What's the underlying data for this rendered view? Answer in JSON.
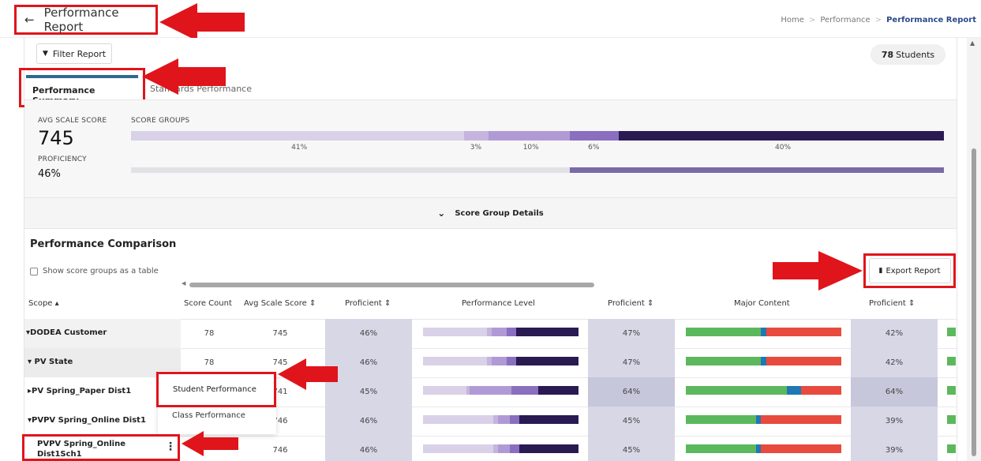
{
  "header": {
    "title": "Performance Report",
    "back_icon": "←",
    "breadcrumb": [
      "Home",
      "Performance",
      "Performance Report"
    ],
    "breadcrumb_sep": ">"
  },
  "toolbar": {
    "filter_label": "Filter Report",
    "students_count": "78",
    "students_label": "Students"
  },
  "tabs": [
    {
      "label": "Performance Summary",
      "active": true
    },
    {
      "label": "Standards Performance",
      "active": false
    }
  ],
  "summary": {
    "avg_scale_score_label": "AVG SCALE SCORE",
    "avg_scale_score": "745",
    "proficiency_label": "PROFICIENCY",
    "proficiency": "46%",
    "score_groups_label": "SCORE GROUPS",
    "score_groups": [
      {
        "pct": 41,
        "label": "41%",
        "color": "#d9d1e8"
      },
      {
        "pct": 3,
        "label": "3%",
        "color": "#c5b5de"
      },
      {
        "pct": 10,
        "label": "10%",
        "color": "#b09ad5"
      },
      {
        "pct": 6,
        "label": "6%",
        "color": "#8a6fc0"
      },
      {
        "pct": 40,
        "label": "40%",
        "color": "#2a1a52"
      }
    ],
    "proficiency_bar": {
      "pct": 46,
      "bg": "#e2e2e6",
      "fill": "#7a6aa8"
    }
  },
  "details_toggle": {
    "icon": "⌄",
    "label": "Score Group Details"
  },
  "comparison": {
    "title": "Performance Comparison",
    "show_table_label": "Show score groups as a table",
    "export_label": "Export Report",
    "columns": [
      "Scope ▴",
      "Score Count",
      "Avg Scale Score ⇕",
      "Proficient ⇕",
      "Performance Level",
      "Proficient ⇕",
      "Major Content",
      "Proficient ⇕"
    ],
    "rows": [
      {
        "scope": "▾DODEA Customer",
        "count": "78",
        "avg": "745",
        "prof1": "46%",
        "prof2": "47%",
        "prof3": "42%",
        "pl": [
          41,
          3,
          10,
          6,
          40
        ],
        "mc": [
          48,
          4,
          48
        ]
      },
      {
        "scope": "▾ PV State",
        "count": "78",
        "avg": "745",
        "prof1": "46%",
        "prof2": "47%",
        "prof3": "42%",
        "pl": [
          41,
          3,
          10,
          6,
          40
        ],
        "mc": [
          48,
          4,
          48
        ]
      },
      {
        "scope": "▸PV Spring_Paper Dist1",
        "count": "",
        "avg": "741",
        "prof1": "45%",
        "prof2": "64%",
        "prof3": "64%",
        "pl": [
          28,
          2,
          27,
          17,
          26
        ],
        "mc": [
          65,
          9,
          26
        ]
      },
      {
        "scope": "▾PVPV Spring_Online Dist1",
        "count": "",
        "avg": "746",
        "prof1": "46%",
        "prof2": "45%",
        "prof3": "39%",
        "pl": [
          45,
          3,
          8,
          6,
          38
        ],
        "mc": [
          45,
          3,
          52
        ]
      },
      {
        "scope": "PVPV Spring_Online Dist1Sch1",
        "count": "",
        "avg": "746",
        "prof1": "46%",
        "prof2": "45%",
        "prof3": "39%",
        "pl": [
          45,
          3,
          8,
          6,
          38
        ],
        "mc": [
          45,
          3,
          52
        ]
      }
    ],
    "pl_colors": [
      "#d9d1e8",
      "#c5b5de",
      "#b09ad5",
      "#8a6fc0",
      "#2a1a52"
    ],
    "mc_colors": [
      "#5cb85c",
      "#1f78b4",
      "#e84a3e"
    ]
  },
  "context_menu": {
    "items": [
      "Student Performance",
      "Class Performance"
    ]
  },
  "kebab_icon": "⋮",
  "filter_icon": "▼",
  "export_icon": "▮"
}
